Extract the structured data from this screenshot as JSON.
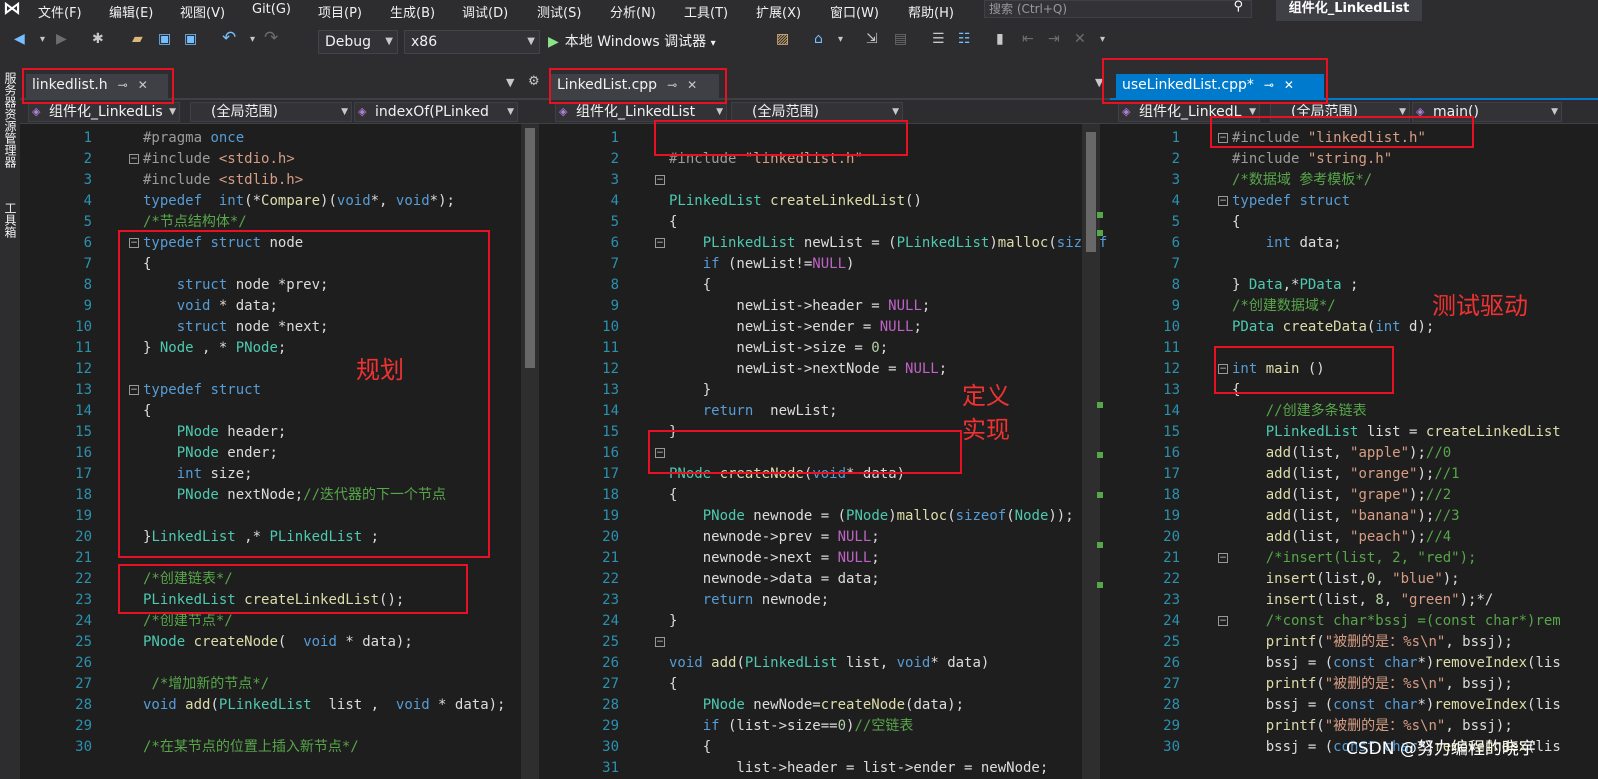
{
  "menu": [
    "文件(F)",
    "编辑(E)",
    "视图(V)",
    "Git(G)",
    "项目(P)",
    "生成(B)",
    "调试(D)",
    "测试(S)",
    "分析(N)",
    "工具(T)",
    "扩展(X)",
    "窗口(W)",
    "帮助(H)"
  ],
  "search_placeholder": "搜索 (Ctrl+Q)",
  "solution_name": "组件化_LinkedList",
  "toolbar": {
    "config": "Debug",
    "platform": "x86",
    "debugger": "本地 Windows 调试器"
  },
  "sidebar": [
    "服务器资源管理器",
    "工具箱"
  ],
  "left": {
    "tab": "linkedlist.h",
    "nav": [
      "组件化_LinkedLis",
      "(全局范围)",
      "indexOf(PLinked"
    ],
    "annotation": "规划",
    "lines": [
      "#pragma once",
      "#include <stdio.h>",
      "#include <stdlib.h>",
      "typedef  int(*Compare)(void*, void*);",
      "/*节点结构体*/",
      "typedef struct node",
      "{",
      "    struct node *prev;",
      "    void * data;",
      "    struct node *next;",
      "} Node , * PNode;",
      "",
      "typedef struct",
      "{",
      "    PNode header;",
      "    PNode ender;",
      "    int size;",
      "    PNode nextNode;//迭代器的下一个节点",
      "",
      "}LinkedList ,* PLinkedList ;",
      "",
      "/*创建链表*/",
      "PLinkedList createLinkedList();",
      "/*创建节点*/",
      "PNode createNode(  void * data);",
      "",
      " /*增加新的节点*/",
      "void add(PLinkedList  list ,  void * data);",
      "",
      "/*在某节点的位置上插入新节点*/"
    ]
  },
  "middle": {
    "tab": "LinkedList.cpp",
    "nav": [
      "组件化_LinkedList",
      "(全局范围)"
    ],
    "annotation": [
      "定义",
      "实现"
    ],
    "lines": [
      "",
      "#include \"linkedlist.h\"",
      "",
      "PLinkedList createLinkedList()",
      "{",
      "    PLinkedList newList = (PLinkedList)malloc(sizeof",
      "    if (newList!=NULL)",
      "    {",
      "        newList->header = NULL;",
      "        newList->ender = NULL;",
      "        newList->size = 0;",
      "        newList->nextNode = NULL;",
      "    }",
      "    return  newList;",
      "}",
      "",
      "PNode createNode(void* data)",
      "{",
      "    PNode newnode = (PNode)malloc(sizeof(Node));",
      "    newnode->prev = NULL;",
      "    newnode->next = NULL;",
      "    newnode->data = data;",
      "    return newnode;",
      "}",
      "",
      "void add(PLinkedList list, void* data)",
      "{",
      "    PNode newNode=createNode(data);",
      "    if (list->size==0)//空链表",
      "    {",
      "        list->header = list->ender = newNode;"
    ]
  },
  "right": {
    "tab": "useLinkedList.cpp*",
    "nav": [
      "组件化_LinkedL",
      "(全局范围)",
      "main()"
    ],
    "annotation": "测试驱动",
    "lines": [
      "#include \"linkedlist.h\"",
      "#include \"string.h\"",
      "/*数据域 参考模板*/",
      "typedef struct",
      "{",
      "    int data;",
      "",
      "} Data,*PData ;",
      "/*创建数据域*/",
      "PData createData(int d);",
      "",
      "int main ()",
      "{",
      "    //创建多条链表",
      "    PLinkedList list = createLinkedList",
      "    add(list, \"apple\");//0",
      "    add(list, \"orange\");//1",
      "    add(list, \"grape\");//2",
      "    add(list, \"banana\");//3",
      "    add(list, \"peach\");//4",
      "    /*insert(list, 2, \"red\");",
      "    insert(list,0, \"blue\");",
      "    insert(list, 8, \"green\");*/",
      "    /*const char*bssj =(const char*)rem",
      "    printf(\"被删的是：%s\\n\", bssj);",
      "    bssj = (const char*)removeIndex(lis",
      "    printf(\"被删的是：%s\\n\", bssj);",
      "    bssj = (const char*)removeIndex(lis",
      "    printf(\"被删的是：%s\\n\", bssj);",
      "    bssj = (const char*)removeIndex(lis"
    ]
  },
  "watermark": "CSDN @努力编程的晓宇"
}
